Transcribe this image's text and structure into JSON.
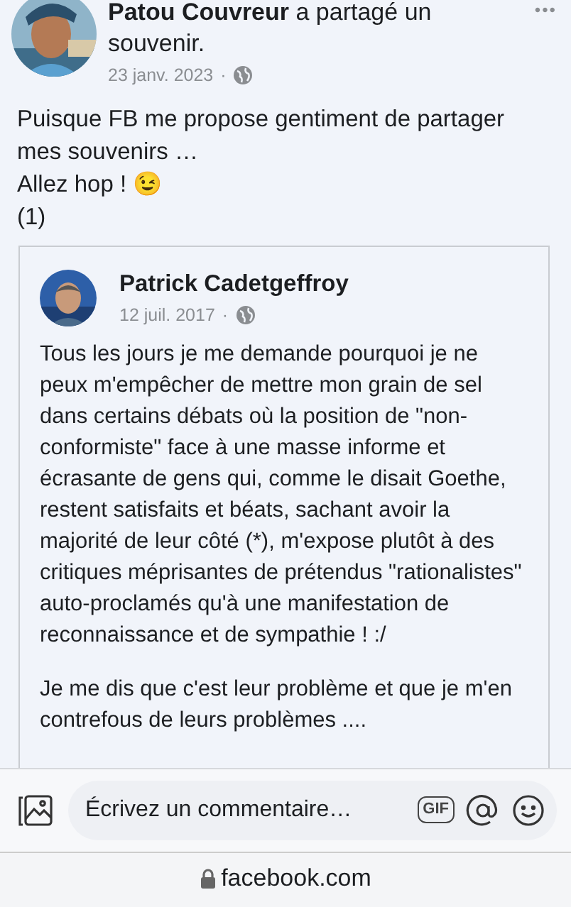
{
  "post": {
    "author": "Patou Couvreur",
    "action": "a partagé un souvenir.",
    "date": "23 janv. 2023",
    "separator": "·",
    "more": "•••",
    "text_lines": [
      "Puisque FB me propose gentiment de partager mes souvenirs …",
      "Allez hop ! 😉",
      "(1)"
    ]
  },
  "shared_post": {
    "author": "Patrick Cadetgeffroy",
    "date": "12 juil. 2017",
    "separator": "·",
    "paragraphs": [
      "Tous les jours je me demande pourquoi je ne peux m'empêcher de mettre mon grain de sel dans certains débats où la position de \"non-conformiste\" face à une masse informe et écrasante de gens qui, comme le disait Goethe, restent satisfaits et béats, sachant avoir la majorité de leur côté (*), m'expose plutôt à des critiques méprisantes de prétendus \"rationalistes\" auto-proclamés qu'à une manifestation de reconnaissance et de sympathie ! :/",
      "Je me dis que c'est leur problème et que je m'en contrefous de leurs problèmes ...."
    ]
  },
  "comment_bar": {
    "placeholder": "Écrivez un commentaire…",
    "gif": "GIF"
  },
  "address_bar": {
    "url": "facebook.com"
  }
}
